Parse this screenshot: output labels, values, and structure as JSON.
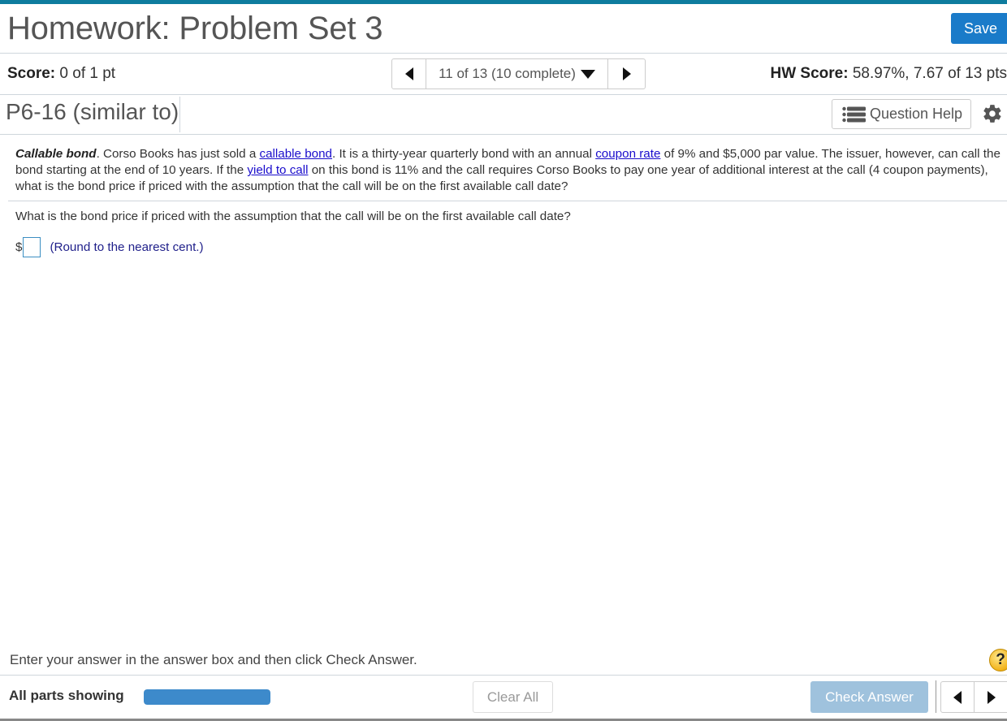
{
  "header": {
    "title": "Homework: Problem Set 3",
    "save_label": "Save",
    "accent_color": "#0e7c9e"
  },
  "score_bar": {
    "score_label": "Score:",
    "score_value": "0 of 1 pt",
    "nav_text": "11 of 13 (10 complete)",
    "hw_score_label": "HW Score:",
    "hw_score_value": "58.97%, 7.67 of 13 pts"
  },
  "question_header": {
    "id": "P6-16 (similar to)",
    "help_label": "Question Help"
  },
  "problem": {
    "lead": "Callable bond",
    "text_1": ". Corso Books has just sold a ",
    "link_1": "callable bond",
    "text_2": ". It is a thirty-year quarterly bond with an annual ",
    "link_2": "coupon rate",
    "text_3": " of 9% and $5,000 par value. The issuer, however, can call the bond starting at the end of 10 years. If the ",
    "link_3": "yield to call",
    "text_4": " on this bond is 11% and the call requires Corso Books to pay one year of additional interest at the call (4 coupon payments), what is the bond price if priced with the assumption that the call will be on the first available call date?"
  },
  "question": {
    "text": "What is the bond price if priced with the assumption that the call will be on the first available call date?",
    "currency": "$",
    "answer_value": "",
    "hint": "(Round to the nearest cent.)"
  },
  "footer": {
    "instruction": "Enter your answer in the answer box and then click Check Answer.",
    "help_symbol": "?",
    "parts_label": "All parts showing",
    "parts_progress_percent": 100,
    "clear_label": "Clear All",
    "check_label": "Check Answer"
  }
}
